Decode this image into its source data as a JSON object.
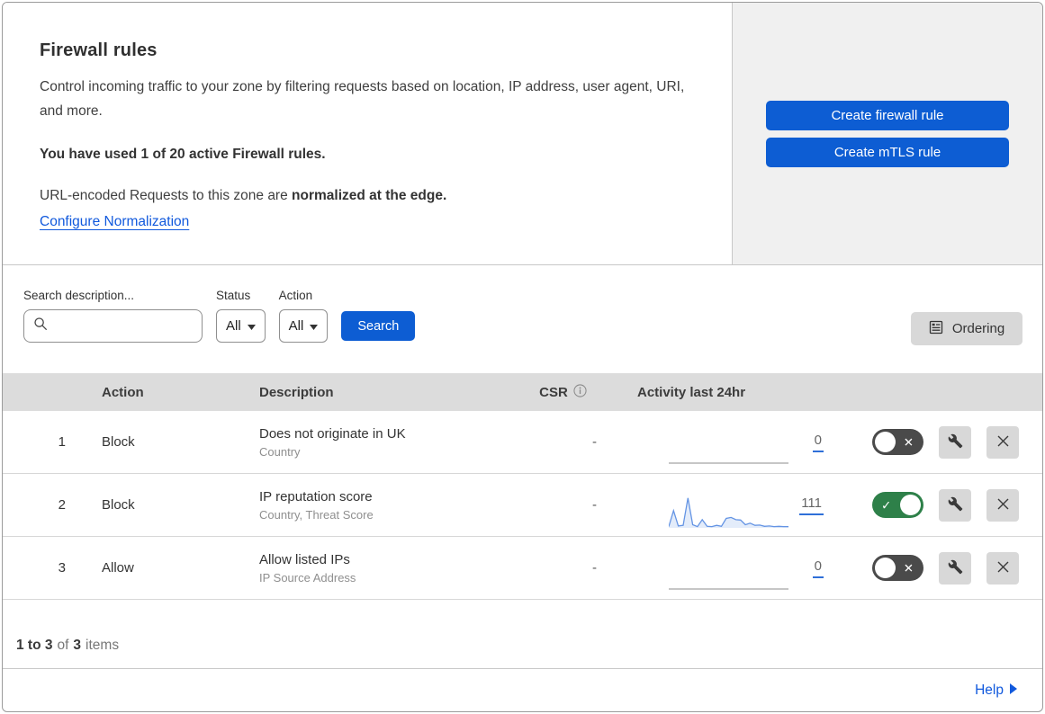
{
  "colors": {
    "primary_blue": "#0d5dd3",
    "link_blue": "#1159dd",
    "toggle_on_green": "#2e8049",
    "toggle_off_gray": "#4a4a4a",
    "panel_gray": "#f0f0f0",
    "table_header_gray": "#dcdcdc",
    "control_gray": "#d8d8d8",
    "sparkline_stroke": "#6494e4",
    "sparkline_fill": "rgba(100,148,228,0.18)"
  },
  "header": {
    "title": "Firewall rules",
    "description": "Control incoming traffic to your zone by filtering requests based on location, IP address, user agent, URI, and more.",
    "usage_line": "You have used 1 of 20 active Firewall rules.",
    "normalization_prefix": "URL-encoded Requests to this zone are ",
    "normalization_bold": "normalized at the edge.",
    "normalization_link": "Configure Normalization",
    "create_firewall_button": "Create firewall rule",
    "create_mtls_button": "Create mTLS rule"
  },
  "filters": {
    "search_label": "Search description...",
    "search_value": "",
    "status_label": "Status",
    "status_value": "All",
    "action_label": "Action",
    "action_value": "All",
    "search_button": "Search",
    "ordering_button": "Ordering"
  },
  "table": {
    "columns": {
      "action": "Action",
      "description": "Description",
      "csr": "CSR",
      "activity": "Activity last 24hr"
    },
    "rows": [
      {
        "priority": "1",
        "action": "Block",
        "description": "Does not originate in UK",
        "fields": "Country",
        "csr": "-",
        "activity_count": "0",
        "enabled": false
      },
      {
        "priority": "2",
        "action": "Block",
        "description": "IP reputation score",
        "fields": "Country, Threat Score",
        "csr": "-",
        "activity_count": "111",
        "enabled": true
      },
      {
        "priority": "3",
        "action": "Allow",
        "description": "Allow listed IPs",
        "fields": "IP Source Address",
        "csr": "-",
        "activity_count": "0",
        "enabled": false
      }
    ]
  },
  "chart_data": {
    "type": "area",
    "title": "Activity last 24hr sparkline (rule 2)",
    "axes": "hidden",
    "total": 111,
    "values": [
      4,
      55,
      6,
      8,
      95,
      10,
      4,
      26,
      5,
      4,
      8,
      5,
      30,
      33,
      26,
      25,
      10,
      15,
      8,
      9,
      5,
      6,
      4,
      5,
      4,
      4
    ]
  },
  "footer": {
    "range": "1 to 3",
    "of_text": "of",
    "total": "3",
    "items_text": "items",
    "help_label": "Help"
  }
}
